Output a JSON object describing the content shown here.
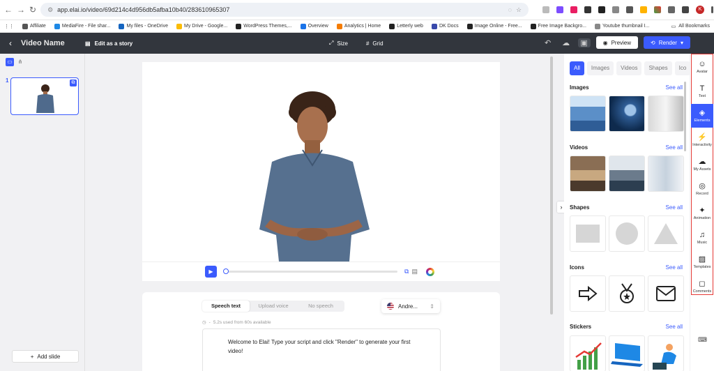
{
  "browser": {
    "url": "app.elai.io/video/69d214c4d956db5afba10b40/283610965307",
    "profile_initial": "K",
    "bookmarks": [
      {
        "label": "Affiliate",
        "color": "#555"
      },
      {
        "label": "MediaFire - File shar...",
        "color": "#1e88e5"
      },
      {
        "label": "My files - OneDrive",
        "color": "#1565c0"
      },
      {
        "label": "My Drive - Google...",
        "color": "#fbbc04"
      },
      {
        "label": "WordPress Themes,...",
        "color": "#222"
      },
      {
        "label": "Overview",
        "color": "#1a73e8"
      },
      {
        "label": "Analytics | Home",
        "color": "#f57c00"
      },
      {
        "label": "Letterly web",
        "color": "#222"
      },
      {
        "label": "DK Docs",
        "color": "#3949ab"
      },
      {
        "label": "Image Online - Free...",
        "color": "#222"
      },
      {
        "label": "Free Image Backgro...",
        "color": "#222"
      },
      {
        "label": "Youtube thumbnail I...",
        "color": "#888"
      }
    ],
    "all_bookmarks": "All Bookmarks"
  },
  "topbar": {
    "video_name": "Video Name",
    "edit_story": "Edit as a story",
    "size": "Size",
    "grid": "Grid",
    "preview": "Preview",
    "render": "Render"
  },
  "slides": {
    "number": "1",
    "add_slide": "Add slide"
  },
  "script": {
    "tabs": [
      "Speech text",
      "Upload voice",
      "No speech"
    ],
    "active_tab": 0,
    "voice": "Andre...",
    "usage": "5.2s used from 60s available",
    "text_line1": "Welcome to Elai! Type your script and click \"Render\" to generate your first",
    "text_line2": "video!"
  },
  "elements_panel": {
    "filters": [
      "All",
      "Images",
      "Videos",
      "Shapes",
      "Ico"
    ],
    "see_all": "See all",
    "sections": {
      "images": "Images",
      "videos": "Videos",
      "shapes": "Shapes",
      "icons": "Icons",
      "stickers": "Stickers"
    }
  },
  "rail": [
    {
      "label": "Avatar",
      "icon": "avatar-icon"
    },
    {
      "label": "Text",
      "icon": "text-icon"
    },
    {
      "label": "Elements",
      "icon": "elements-icon",
      "active": true
    },
    {
      "label": "Interactivity",
      "icon": "interactivity-icon"
    },
    {
      "label": "My Assets",
      "icon": "my-assets-icon"
    },
    {
      "label": "Record",
      "icon": "record-icon"
    },
    {
      "label": "Animation",
      "icon": "animation-icon"
    },
    {
      "label": "Music",
      "icon": "music-icon"
    },
    {
      "label": "Templates",
      "icon": "templates-icon"
    },
    {
      "label": "Comments",
      "icon": "comments-icon"
    }
  ],
  "colors": {
    "accent": "#3b5bfd",
    "topbar": "#32363d",
    "highlight_box": "#e53935"
  }
}
